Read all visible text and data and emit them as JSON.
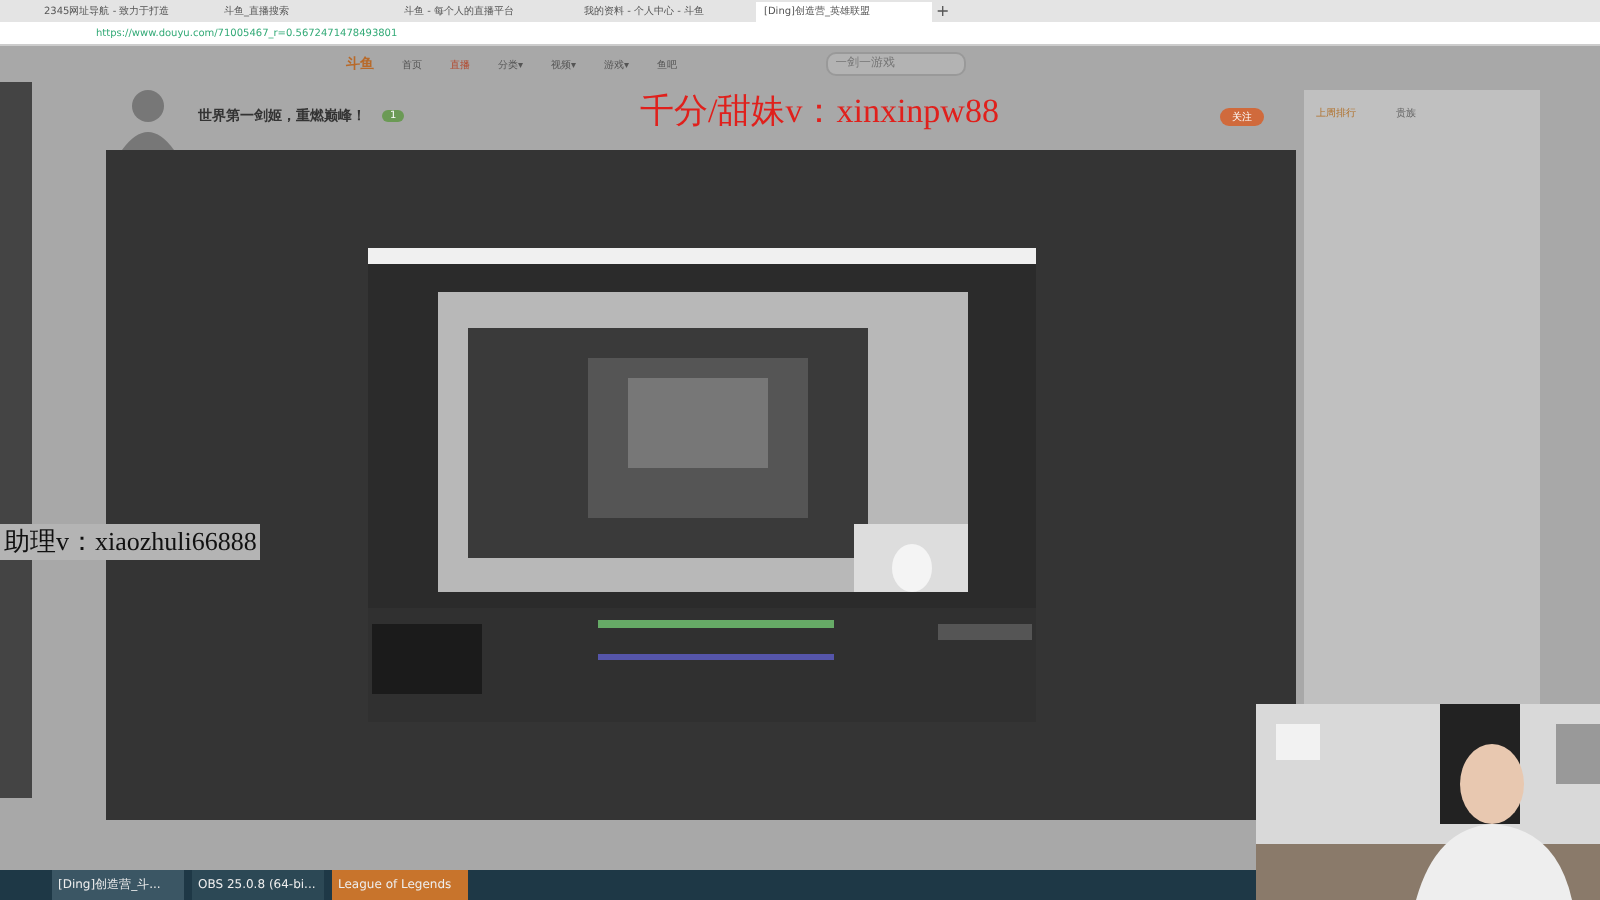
{
  "browser": {
    "tabs": [
      {
        "title": "2345网址导航 - 致力于打造",
        "selected": false
      },
      {
        "title": "斗鱼_直播搜索",
        "selected": false
      },
      {
        "title": "斗鱼 - 每个人的直播平台",
        "selected": false
      },
      {
        "title": "我的资料 - 个人中心 - 斗鱼",
        "selected": false
      },
      {
        "title": "[Ding]创造营_英雄联盟",
        "selected": true
      }
    ],
    "new_tab": "+",
    "url": "https://www.douyu.com/71005467_r=0.5672471478493801"
  },
  "site_nav": {
    "logo": "斗鱼",
    "items": [
      {
        "label": "首页",
        "selected": false
      },
      {
        "label": "直播",
        "selected": true
      },
      {
        "label": "分类▾",
        "selected": false
      },
      {
        "label": "视频▾",
        "selected": false
      },
      {
        "label": "游戏▾",
        "selected": false
      },
      {
        "label": "鱼吧",
        "selected": false
      }
    ],
    "search": {
      "placeholder": "一剑一游戏"
    }
  },
  "room": {
    "title": "世界第一剑姬，重燃巅峰！",
    "follow": "关注",
    "fans": "1"
  },
  "overlays": [
    {
      "text": "千分/甜妹v：xinxinpw88",
      "kind": "red"
    },
    {
      "text": "助理v：xiaozhuli66888",
      "kind": "dark"
    }
  ],
  "sidebar": {
    "tabs": [
      {
        "label": "上周排行",
        "selected": true
      },
      {
        "label": "贵族",
        "selected": false
      }
    ]
  },
  "taskbar": {
    "items": [
      {
        "label": "[Ding]创造营_斗...",
        "kind": "browser",
        "selected": true
      },
      {
        "label": "OBS 25.0.8 (64-bi...",
        "kind": "obs",
        "selected": false
      },
      {
        "label": "League of Legends",
        "kind": "game",
        "selected": false
      }
    ]
  }
}
